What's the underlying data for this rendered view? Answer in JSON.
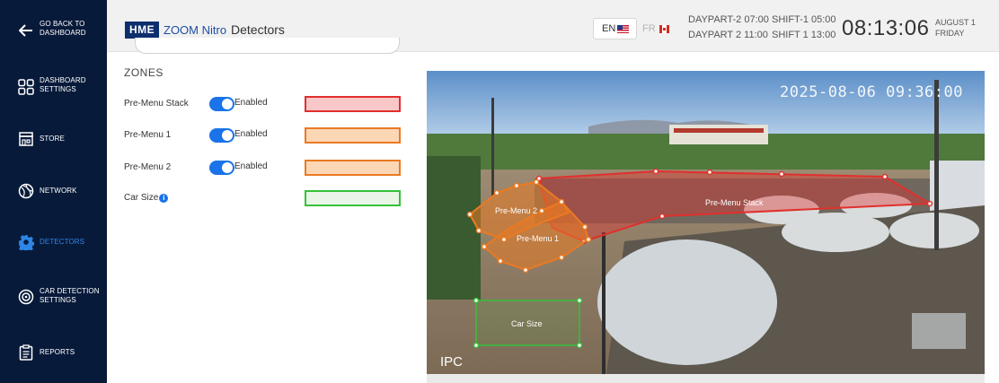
{
  "sidebar": {
    "back": {
      "line1": "GO BACK TO",
      "line2": "DASHBOARD",
      "icon": "back-arrow-icon"
    },
    "items": [
      {
        "id": "dashboard-settings",
        "line1": "DASHBOARD",
        "line2": "SETTINGS",
        "icon": "grid-icon",
        "active": false
      },
      {
        "id": "store",
        "line1": "STORE",
        "line2": "",
        "icon": "store-icon",
        "active": false
      },
      {
        "id": "network",
        "line1": "NETWORK",
        "line2": "",
        "icon": "network-icon",
        "active": false
      },
      {
        "id": "detectors",
        "line1": "DETECTORS",
        "line2": "",
        "icon": "gear-icon",
        "active": true
      },
      {
        "id": "car-detection-settings",
        "line1": "CAR DETECTION",
        "line2": "SETTINGS",
        "icon": "radar-icon",
        "active": false
      },
      {
        "id": "reports",
        "line1": "REPORTS",
        "line2": "",
        "icon": "clipboard-icon",
        "active": false
      }
    ]
  },
  "header": {
    "logo": "HME",
    "brand": "ZOOM Nitro",
    "title": "Detectors",
    "lang_en": "EN",
    "lang_fr": "FR",
    "dayparts": [
      {
        "daypart": "DAYPART-2 07:00",
        "shift": "SHIFT-1 05:00"
      },
      {
        "daypart": "DAYPART 2 11:00",
        "shift": "SHIFT 1 13:00"
      }
    ],
    "time": "08:13:06",
    "date_line1": "AUGUST 1",
    "date_line2": "FRIDAY"
  },
  "zones": {
    "title": "ZONES",
    "rows": [
      {
        "name": "Pre-Menu Stack",
        "enabled": true,
        "toggle_label": "Enabled",
        "color_fill": "#f8c7c8",
        "color_border": "#e0302d"
      },
      {
        "name": "Pre-Menu 1",
        "enabled": true,
        "toggle_label": "Enabled",
        "color_fill": "#fbd7b6",
        "color_border": "#ea7a22"
      },
      {
        "name": "Pre-Menu 2",
        "enabled": true,
        "toggle_label": "Enabled",
        "color_fill": "#fbd7b6",
        "color_border": "#ea7a22"
      }
    ],
    "car_size": {
      "name": "Car Size",
      "color_fill": "#e9f6e7",
      "color_border": "#34c13a"
    }
  },
  "camera": {
    "timestamp": "2025-08-06 09:36:00",
    "source": "IPC",
    "zone_labels": {
      "stack": "Pre-Menu Stack",
      "menu1": "Pre-Menu 1",
      "menu2": "Pre-Menu 2",
      "car_size": "Car Size"
    }
  },
  "colors": {
    "sidebar_bg": "#081a3a",
    "active_accent": "#2d86e6",
    "toggle_on": "#1a73e8"
  }
}
